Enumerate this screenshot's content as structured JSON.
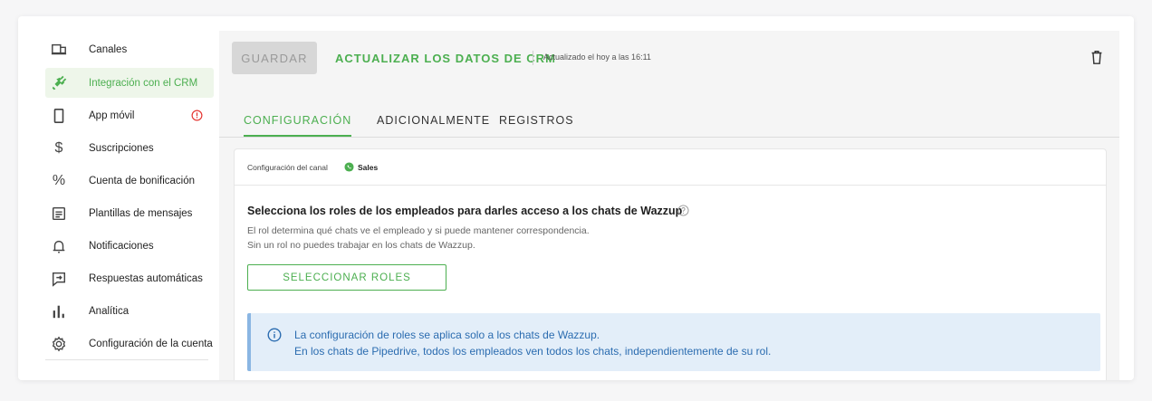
{
  "sidebar": {
    "items": [
      {
        "label": "Canales",
        "icon": "channels-icon"
      },
      {
        "label": "Integración con el CRM",
        "icon": "plug-icon",
        "active": true
      },
      {
        "label": "App móvil",
        "icon": "mobile-icon",
        "alert": true
      },
      {
        "label": "Suscripciones",
        "icon": "dollar-icon"
      },
      {
        "label": "Cuenta de bonificación",
        "icon": "percent-icon"
      },
      {
        "label": "Plantillas de mensajes",
        "icon": "template-icon"
      },
      {
        "label": "Notificaciones",
        "icon": "bell-icon"
      },
      {
        "label": "Respuestas automáticas",
        "icon": "auto-reply-icon"
      },
      {
        "label": "Analítica",
        "icon": "analytics-icon"
      },
      {
        "label": "Configuración de la cuenta",
        "icon": "gear-icon"
      }
    ]
  },
  "toolbar": {
    "save_label": "GUARDAR",
    "update_label": "ACTUALIZAR LOS DATOS DE CRM",
    "updated_text": "Actualizado el hoy a las 16:11"
  },
  "tabs": [
    {
      "label": "CONFIGURACIÓN",
      "active": true
    },
    {
      "label": "ADICIONALMENTE"
    },
    {
      "label": "REGISTROS"
    }
  ],
  "panel": {
    "channel_label": "Configuración del canal",
    "channel_name": "Sales",
    "heading": "Selecciona los roles de los empleados para darles acceso a los chats de Wazzup",
    "desc_line1": "El rol determina qué chats ve el empleado y si puede mantener correspondencia.",
    "desc_line2": "Sin un rol no puedes trabajar en los chats de Wazzup.",
    "roles_button": "SELECCIONAR ROLES",
    "info_line1": "La configuración de roles se aplica solo a los chats de Wazzup.",
    "info_line2": "En los chats de Pipedrive, todos los empleados ven todos los chats, independientemente de su rol."
  },
  "colors": {
    "accent": "#4caf50",
    "alert": "#e53935",
    "info_bg": "#e3eef9",
    "info_text": "#2b6cb0"
  }
}
